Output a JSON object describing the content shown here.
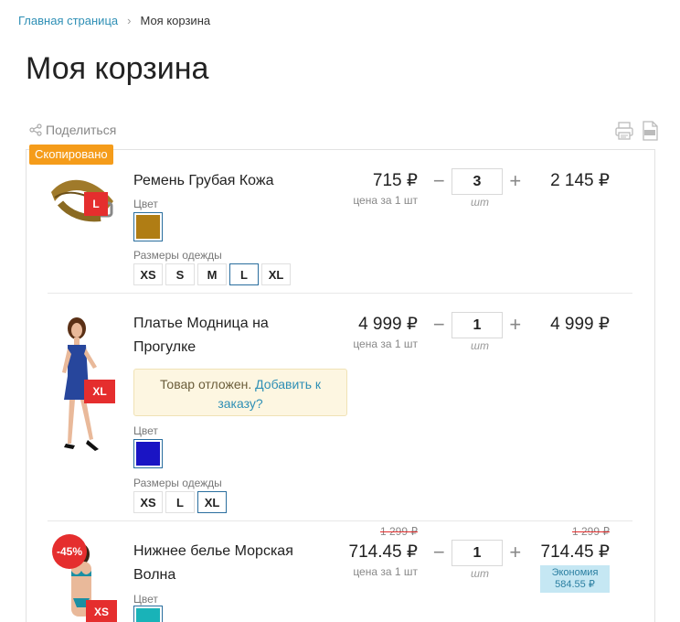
{
  "breadcrumb": {
    "home": "Главная страница",
    "separator": "›",
    "current": "Моя корзина"
  },
  "page_title": "Моя корзина",
  "share_label": "Поделиться",
  "copied_badge": "Скопировано",
  "labels": {
    "color": "Цвет",
    "sizes": "Размеры одежды",
    "unit_note": "цена за 1 шт",
    "qty_unit": "шт"
  },
  "items": [
    {
      "name": "Ремень Грубая Кожа",
      "size_tag": "L",
      "unit_price": "715 ₽",
      "quantity": "3",
      "total": "2 145 ₽",
      "color_hex": "#b07d14",
      "sizes": [
        "XS",
        "S",
        "M",
        "L",
        "XL"
      ],
      "selected_size": "L"
    },
    {
      "name": "Платье Модница на Прогулке",
      "size_tag": "XL",
      "unit_price": "4 999 ₽",
      "quantity": "1",
      "total": "4 999 ₽",
      "deferred_text": "Товар отложен.",
      "deferred_link": "Добавить к заказу?",
      "color_hex": "#1a14c4",
      "sizes": [
        "XS",
        "L",
        "XL"
      ],
      "selected_size": "XL"
    },
    {
      "name": "Нижнее белье Морская Волна",
      "size_tag": "XS",
      "discount": "-45%",
      "old_unit_price": "1 299 ₽",
      "unit_price": "714.45 ₽",
      "quantity": "1",
      "old_total": "1 299 ₽",
      "total": "714.45 ₽",
      "savings_label": "Экономия",
      "savings_value": "584.55 ₽",
      "color_hex": "#19b3b8"
    }
  ],
  "qty_controls": {
    "minus": "−",
    "plus": "+"
  }
}
